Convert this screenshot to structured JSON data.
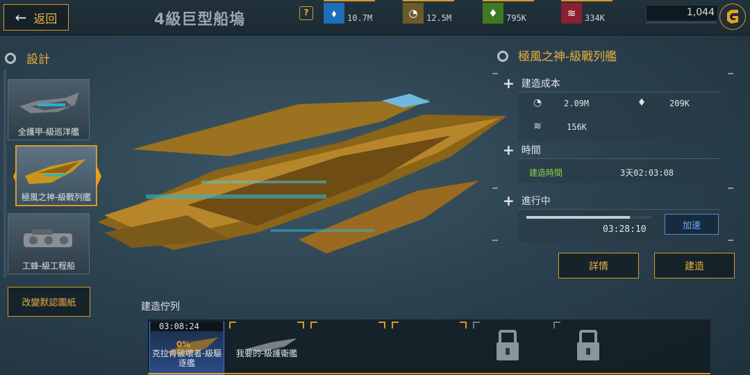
{
  "header": {
    "back_label": "返回",
    "title": "4級巨型船塢",
    "help_icon": "?",
    "resources": [
      {
        "icon": "blue-crystal-icon",
        "value": "10.7M",
        "color": "#1c6fb8"
      },
      {
        "icon": "ore-icon",
        "value": "12.5M",
        "color": "#6b5a2a"
      },
      {
        "icon": "green-crystal-icon",
        "value": "795K",
        "color": "#3f7a22"
      },
      {
        "icon": "metal-stack-icon",
        "value": "334K",
        "color": "#8a2030"
      }
    ],
    "credits": "1,044"
  },
  "left_panel": {
    "title": "設計",
    "ships": [
      {
        "name": "全護甲-級巡洋艦"
      },
      {
        "name": "極風之神-級戰列艦"
      },
      {
        "name": "工蜂-級工程船"
      }
    ],
    "change_blueprint_label": "改變默認圖紙"
  },
  "ship_info": {
    "name": "極風之神-級戰列艦",
    "cost": {
      "heading": "建造成本",
      "ore": "2.09M",
      "crystal": "209K",
      "metal": "156K"
    },
    "time": {
      "heading": "時間",
      "label": "建造時間",
      "value": "3天02:03:08"
    },
    "in_progress": {
      "heading": "進行中",
      "remaining": "03:28:10",
      "progress": 0.83,
      "speedup_label": "加速"
    },
    "details_label": "詳情",
    "build_label": "建造"
  },
  "queue": {
    "label": "建造佇列",
    "active": {
      "timer": "03:08:24",
      "percent": "0%",
      "name": "克拉肯破壞者-級驅逐艦"
    },
    "waiting": {
      "name": "我要的-級護衛艦"
    }
  }
}
